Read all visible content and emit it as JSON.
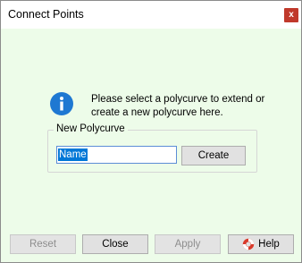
{
  "window": {
    "title": "Connect Points",
    "close_glyph": "x"
  },
  "message": {
    "icon": "info-icon",
    "text": "Please select a polycurve to extend or create a new polycurve here."
  },
  "new_polycurve": {
    "group_label": "New Polycurve",
    "name_value": "Name",
    "create_label": "Create"
  },
  "buttons": {
    "reset_label": "Reset",
    "close_label": "Close",
    "apply_label": "Apply",
    "help_label": "Help",
    "help_icon": "lifebuoy-icon"
  },
  "colors": {
    "client_background": "#edfce9",
    "close_button": "#c0392b",
    "info_icon": "#1e78d2",
    "selection": "#0078d7"
  }
}
